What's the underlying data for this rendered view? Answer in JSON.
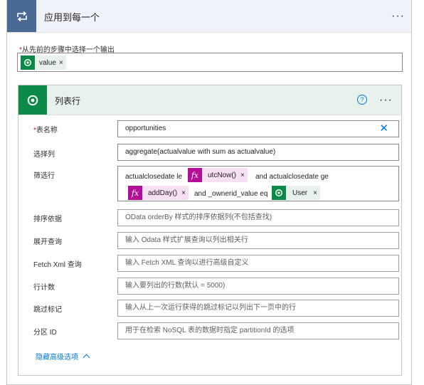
{
  "header": {
    "title": "应用到每一个",
    "more": "···"
  },
  "select_output": {
    "label": "从先前的步骤中选择一个输出",
    "required": "*",
    "token": {
      "label": "value",
      "close": "×",
      "icon": "dataverse-icon"
    }
  },
  "action": {
    "title": "列表行",
    "help": "?",
    "more": "···",
    "icon": "dataverse-icon",
    "fields": {
      "table_name": {
        "label": "表名称",
        "required": "*",
        "value": "opportunities",
        "clear": "✕"
      },
      "select_columns": {
        "label": "选择列",
        "value": "aggregate(actualvalue with sum as actualvalue)"
      },
      "filter": {
        "label": "筛选行",
        "line1_text_a": "actualclosedate le",
        "fx1": {
          "icon": "fx",
          "label": "utcNow()",
          "close": "×"
        },
        "line1_text_b": "and actualclosedate ge",
        "fx2": {
          "icon": "fx",
          "label": "addDay()",
          "close": "×"
        },
        "line2_text_a": "and _ownerid_value eq",
        "user_token": {
          "label": "User",
          "close": "×",
          "icon": "dataverse-icon"
        }
      },
      "sort_by": {
        "label": "排序依据",
        "placeholder": "OData orderBy 样式的排序依据列(不包括查找)"
      },
      "expand_query": {
        "label": "展开查询",
        "placeholder": "输入 Odata 样式扩展查询以列出相关行"
      },
      "fetch_xml": {
        "label": "Fetch Xml 查询",
        "placeholder": "输入 Fetch XML 查询以进行高级自定义"
      },
      "row_count": {
        "label": "行计数",
        "placeholder": "输入要列出的行数(默认 = 5000)"
      },
      "skip_token": {
        "label": "跳过标记",
        "placeholder": "输入从上一次运行获得的跳过标记以列出下一页中的行"
      },
      "partition_id": {
        "label": "分区 ID",
        "placeholder": "用于在检索 NoSQL 表的数据时指定 partitionId 的选项"
      }
    },
    "hide_advanced": "隐藏高级选项"
  },
  "colors": {
    "header_bg": "#eff2f8",
    "loop_icon_bg": "#486991",
    "dataverse_green": "#0a8a46",
    "action_header_bg": "#e8f1ec",
    "fx_purple": "#b40e99",
    "link_blue": "#0078d4",
    "required_red": "#a4262c"
  }
}
